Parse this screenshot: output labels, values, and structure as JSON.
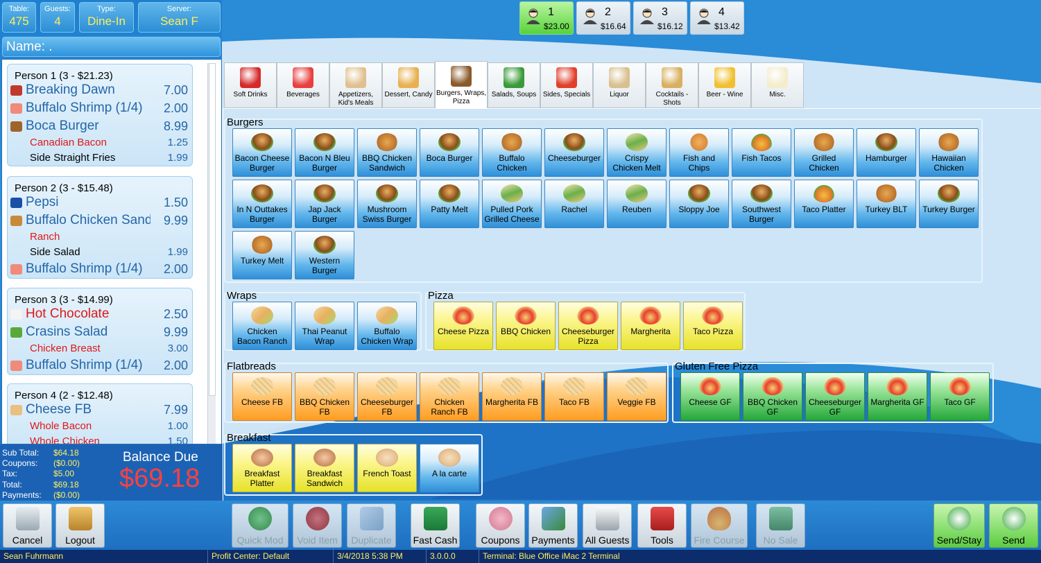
{
  "header": {
    "table": {
      "label": "Table:",
      "value": "475"
    },
    "guests": {
      "label": "Guests:",
      "value": "4"
    },
    "type": {
      "label": "Type:",
      "value": "Dine-In"
    },
    "server": {
      "label": "Server:",
      "value": "Sean F"
    },
    "name_label": "Name: ."
  },
  "guest_tabs": [
    {
      "number": "1",
      "amount": "$23.00",
      "selected": true
    },
    {
      "number": "2",
      "amount": "$16.64"
    },
    {
      "number": "3",
      "amount": "$16.12"
    },
    {
      "number": "4",
      "amount": "$13.42"
    }
  ],
  "order": {
    "persons": [
      {
        "header": "Person 1 (3 - $21.23)",
        "lines": [
          {
            "kind": "item",
            "name": "Breaking Dawn",
            "price": "7.00",
            "icon": "drink-icon"
          },
          {
            "kind": "item",
            "name": "Buffalo Shrimp (1/4)",
            "price": "2.00",
            "icon": "shrimp-icon"
          },
          {
            "kind": "item",
            "name": "Boca Burger",
            "price": "8.99",
            "icon": "burger-icon"
          },
          {
            "kind": "mod",
            "name": "Canadian Bacon",
            "price": "1.25"
          },
          {
            "kind": "side",
            "name": "Side Straight Fries",
            "price": "1.99"
          }
        ]
      },
      {
        "header": "Person 2 (3 - $15.48)",
        "lines": [
          {
            "kind": "item",
            "name": "Pepsi",
            "price": "1.50",
            "icon": "pepsi-icon"
          },
          {
            "kind": "item",
            "name": "Buffalo Chicken Sand",
            "price": "9.99",
            "icon": "chicken-icon"
          },
          {
            "kind": "mod",
            "name": "Ranch",
            "price": ""
          },
          {
            "kind": "side",
            "name": "Side Salad",
            "price": "1.99"
          },
          {
            "kind": "item",
            "name": "Buffalo Shrimp (1/4)",
            "price": "2.00",
            "icon": "shrimp-icon"
          }
        ]
      },
      {
        "header": "Person 3 (3 - $14.99)",
        "lines": [
          {
            "kind": "item",
            "name": "Hot Chocolate",
            "price": "2.50",
            "icon": "cup-icon",
            "red": true
          },
          {
            "kind": "item",
            "name": "Crasins Salad",
            "price": "9.99",
            "icon": "salad-icon"
          },
          {
            "kind": "mod",
            "name": "Chicken Breast",
            "price": "3.00"
          },
          {
            "kind": "item",
            "name": "Buffalo Shrimp (1/4)",
            "price": "2.00",
            "icon": "shrimp-icon"
          }
        ]
      },
      {
        "header": "Person 4 (2 - $12.48)",
        "lines": [
          {
            "kind": "item",
            "name": "Cheese FB",
            "price": "7.99",
            "icon": "flatbread-icon"
          },
          {
            "kind": "mod",
            "name": "Whole Bacon",
            "price": "1.00"
          },
          {
            "kind": "mod",
            "name": "Whole Chicken",
            "price": "1.50"
          }
        ]
      }
    ]
  },
  "totals": {
    "subtotal": {
      "label": "Sub Total:",
      "value": "$64.18"
    },
    "coupons": {
      "label": "Coupons:",
      "value": "($0.00)"
    },
    "tax": {
      "label": "Tax:",
      "value": "$5.00"
    },
    "total": {
      "label": "Total:",
      "value": "$69.18"
    },
    "payments": {
      "label": "Payments:",
      "value": "($0.00)"
    },
    "balance_label": "Balance Due",
    "balance_value": "$69.18"
  },
  "tabs": [
    {
      "label": "Soft Drinks",
      "icon": "soda-can-icon",
      "color": "#d62a2a"
    },
    {
      "label": "Beverages",
      "icon": "milk-carton-icon",
      "color": "#e84040"
    },
    {
      "label": "Appetizers, Kid's Meals",
      "icon": "pie-slice-icon",
      "color": "#e0c090"
    },
    {
      "label": "Dessert, Candy",
      "icon": "ice-cream-icon",
      "color": "#e8b050"
    },
    {
      "label": "Burgers, Wraps, Pizza",
      "icon": "burger-icon",
      "color": "#8a5a2a",
      "selected": true
    },
    {
      "label": "Salads, Soups",
      "icon": "salad-bowl-icon",
      "color": "#3a9a3a"
    },
    {
      "label": "Sides, Specials",
      "icon": "fries-icon",
      "color": "#e0402a"
    },
    {
      "label": "Liquor",
      "icon": "glass-icon",
      "color": "#d8c090"
    },
    {
      "label": "Cocktails - Shots",
      "icon": "cocktail-icon",
      "color": "#d8b060"
    },
    {
      "label": "Beer - Wine",
      "icon": "beer-mug-icon",
      "color": "#f0c030"
    },
    {
      "label": "Misc.",
      "icon": "note-pad-icon",
      "color": "#f4eccc"
    }
  ],
  "sections": {
    "burgers": {
      "title": "Burgers",
      "items": [
        {
          "label": "Bacon Cheese Burger",
          "icon": "burger"
        },
        {
          "label": "Bacon N Bleu Burger",
          "icon": "burger"
        },
        {
          "label": "BBQ Chicken Sandwich",
          "icon": "chicken"
        },
        {
          "label": "Boca Burger",
          "icon": "burger"
        },
        {
          "label": "Buffalo Chicken",
          "icon": "chicken"
        },
        {
          "label": "Cheeseburger",
          "icon": "burger"
        },
        {
          "label": "Crispy Chicken Melt",
          "icon": "sandwich"
        },
        {
          "label": "Fish and Chips",
          "icon": "fish"
        },
        {
          "label": "Fish Tacos",
          "icon": "taco"
        },
        {
          "label": "Grilled Chicken",
          "icon": "chicken"
        },
        {
          "label": "Hamburger",
          "icon": "burger"
        },
        {
          "label": "Hawaiian Chicken",
          "icon": "chicken"
        },
        {
          "label": "In N Outtakes Burger",
          "icon": "burger"
        },
        {
          "label": "Jap Jack Burger",
          "icon": "burger"
        },
        {
          "label": "Mushroom Swiss Burger",
          "icon": "burger"
        },
        {
          "label": "Patty Melt",
          "icon": "burger"
        },
        {
          "label": "Pulled Pork Grilled Cheese",
          "icon": "sandwich"
        },
        {
          "label": "Rachel",
          "icon": "sandwich"
        },
        {
          "label": "Reuben",
          "icon": "sandwich"
        },
        {
          "label": "Sloppy Joe",
          "icon": "burger"
        },
        {
          "label": "Southwest Burger",
          "icon": "burger"
        },
        {
          "label": "Taco Platter",
          "icon": "taco"
        },
        {
          "label": "Turkey BLT",
          "icon": "chicken"
        },
        {
          "label": "Turkey Burger",
          "icon": "burger"
        },
        {
          "label": "Turkey Melt",
          "icon": "chicken"
        },
        {
          "label": "Western Burger",
          "icon": "burger"
        }
      ]
    },
    "wraps": {
      "title": "Wraps",
      "items": [
        {
          "label": "Chicken Bacon Ranch",
          "icon": "wrap"
        },
        {
          "label": "Thai Peanut Wrap",
          "icon": "wrap"
        },
        {
          "label": "Buffalo Chicken Wrap",
          "icon": "wrap"
        }
      ]
    },
    "pizza": {
      "title": "Pizza",
      "items": [
        {
          "label": "Cheese Pizza",
          "icon": "pizza"
        },
        {
          "label": "BBQ Chicken",
          "icon": "pizza"
        },
        {
          "label": "Cheeseburger Pizza",
          "icon": "pizza"
        },
        {
          "label": "Margherita",
          "icon": "pizza"
        },
        {
          "label": "Taco Pizza",
          "icon": "pizza"
        }
      ]
    },
    "flatbreads": {
      "title": "Flatbreads",
      "items": [
        {
          "label": "Cheese FB",
          "icon": "cracker"
        },
        {
          "label": "BBQ Chicken FB",
          "icon": "cracker"
        },
        {
          "label": "Cheeseburger FB",
          "icon": "cracker"
        },
        {
          "label": "Chicken Ranch FB",
          "icon": "cracker"
        },
        {
          "label": "Margherita FB",
          "icon": "cracker"
        },
        {
          "label": "Taco FB",
          "icon": "cracker"
        },
        {
          "label": "Veggie FB",
          "icon": "cracker"
        }
      ]
    },
    "gluten_free": {
      "title": "Gluten Free Pizza",
      "items": [
        {
          "label": "Cheese GF",
          "icon": "pizza"
        },
        {
          "label": "BBQ Chicken GF",
          "icon": "pizza"
        },
        {
          "label": "Cheeseburger GF",
          "icon": "pizza"
        },
        {
          "label": "Margherita GF",
          "icon": "pizza"
        },
        {
          "label": "Taco GF",
          "icon": "pizza"
        }
      ]
    },
    "breakfast": {
      "title": "Breakfast",
      "items": [
        {
          "label": "Breakfast Platter",
          "icon": "egg",
          "color": "yellow"
        },
        {
          "label": "Breakfast Sandwich",
          "icon": "egg",
          "color": "yellow"
        },
        {
          "label": "French Toast",
          "icon": "toast",
          "color": "yellow"
        },
        {
          "label": "A la carte",
          "icon": "toast",
          "color": "blue"
        }
      ]
    }
  },
  "toolbar": {
    "cancel": "Cancel",
    "logout": "Logout",
    "quick_mod": "Quick Mod",
    "void_item": "Void Item",
    "duplicate": "Duplicate",
    "fast_cash": "Fast Cash",
    "coupons": "Coupons",
    "payments": "Payments",
    "all_guests": "All Guests",
    "tools": "Tools",
    "fire_course": "Fire Course",
    "no_sale": "No Sale",
    "send_stay": "Send/Stay",
    "send": "Send"
  },
  "status": {
    "user": "Sean Fuhrmann",
    "profit_center": "Profit Center: Default",
    "datetime": "3/4/2018 5:38 PM",
    "version": "3.0.0.0",
    "terminal": "Terminal: Blue Office iMac 2 Terminal"
  },
  "colors": {
    "accent": "#2f8fd8",
    "red_text": "#e01818",
    "balance": "#ff4040",
    "status_yellow": "#fff060"
  }
}
